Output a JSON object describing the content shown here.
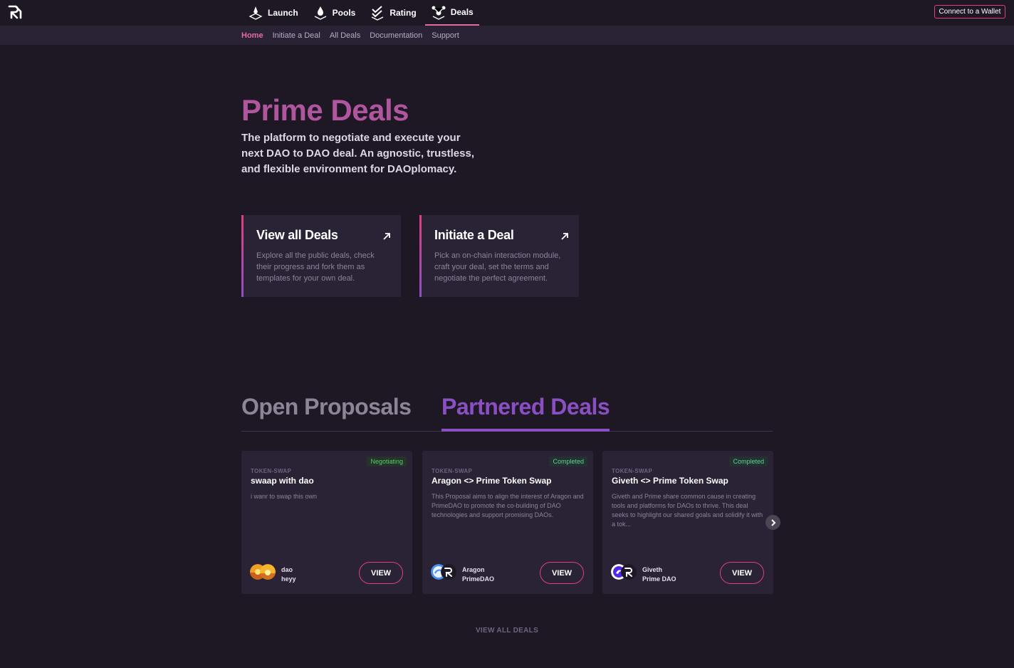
{
  "topbar": {
    "nav": [
      {
        "label": "Launch",
        "icon": "launch-icon"
      },
      {
        "label": "Pools",
        "icon": "pools-icon"
      },
      {
        "label": "Rating",
        "icon": "rating-icon"
      },
      {
        "label": "Deals",
        "icon": "deals-icon",
        "active": true
      }
    ],
    "wallet_label": "Connect to a Wallet"
  },
  "subnav": {
    "items": [
      {
        "label": "Home",
        "active": true
      },
      {
        "label": "Initiate a Deal"
      },
      {
        "label": "All Deals"
      },
      {
        "label": "Documentation"
      },
      {
        "label": "Support"
      }
    ]
  },
  "hero": {
    "title": "Prime Deals",
    "subtitle": "The platform to negotiate and execute your next DAO to DAO deal. An agnostic, trustless, and flexible environment for DAOplomacy."
  },
  "features": [
    {
      "title": "View all Deals",
      "desc": "Explore all the public deals, check their progress and fork them as templates for your own deal."
    },
    {
      "title": "Initiate a Deal",
      "desc": "Pick an on-chain interaction module, craft your deal, set the terms and negotiate the perfect agreement."
    }
  ],
  "tabs": {
    "open": "Open Proposals",
    "partnered": "Partnered Deals"
  },
  "deals": [
    {
      "status": "Negotiating",
      "type": "TOKEN-SWAP",
      "title": "swaap with dao",
      "desc": "i wanr to swap this own",
      "party1": "dao",
      "party2": "heyy",
      "view": "VIEW"
    },
    {
      "status": "Completed",
      "type": "TOKEN-SWAP",
      "title": "Aragon <> Prime Token Swap",
      "desc": "This Proposal aims to align the interest of Aragon and PrimeDAO to promote the co-building of DAO technologies and support promising DAOs.",
      "party1": "Aragon",
      "party2": "PrimeDAO",
      "view": "VIEW"
    },
    {
      "status": "Completed",
      "type": "TOKEN-SWAP",
      "title": "Giveth <> Prime Token Swap",
      "desc": "Giveth and Prime share common cause in creating tools and platforms for DAOs to thrive. This deal seeks to highlight our shared goals and solidify it with a tok...",
      "party1": "Giveth",
      "party2": "Prime DAO",
      "view": "VIEW"
    }
  ],
  "view_all_label": "VIEW ALL DEALS",
  "colors": {
    "background": "#1d1824",
    "panel": "#2a2235",
    "accent_pink": "#e0407d",
    "accent_purple": "#8a4fc3",
    "title": "#b0569f"
  }
}
